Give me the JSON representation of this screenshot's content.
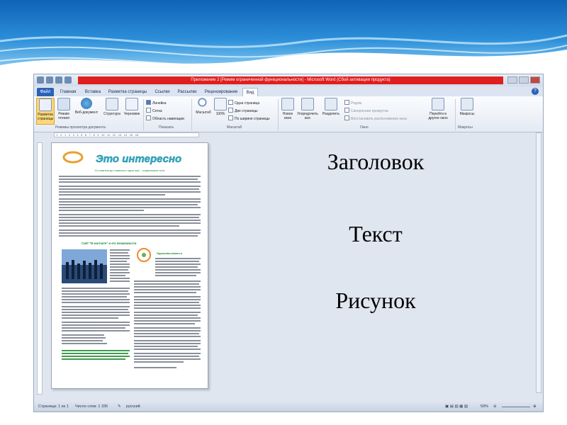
{
  "window": {
    "title": "Приложение 2 [Режим ограниченной функциональности] - Microsoft Word (Сбой активации продукта)"
  },
  "ribbon": {
    "tabs": [
      "Файл",
      "Главная",
      "Вставка",
      "Разметка страницы",
      "Ссылки",
      "Рассылки",
      "Рецензирование",
      "Вид"
    ],
    "active_tab": "Вид",
    "groups": {
      "views": {
        "label": "Режимы просмотра документа",
        "buttons": [
          "Разметка страницы",
          "Режим чтения",
          "Веб-документ",
          "Структура",
          "Черновик"
        ]
      },
      "show": {
        "label": "Показать",
        "options": [
          "Линейка",
          "Сетка",
          "Область навигации"
        ]
      },
      "zoom": {
        "label": "Масштаб",
        "buttons": [
          "Масштаб",
          "100%"
        ],
        "options": [
          "Одна страница",
          "Две страницы",
          "По ширине страницы"
        ]
      },
      "window": {
        "label": "Окно",
        "buttons": [
          "Новое окно",
          "Упорядочить все",
          "Разделить"
        ],
        "options": [
          "Рядом",
          "Синхронная прокрутка",
          "Восстановить расположение окна"
        ],
        "switch": "Перейти в другое окно"
      },
      "macros": {
        "label": "Макросы",
        "button": "Макросы"
      }
    }
  },
  "document": {
    "banner_title": "Это интересно",
    "subtitle": "10 советов до новичкого один шаг - социальные сети",
    "section_title": "Сайт \"В контакте\" и его возможности",
    "side_title": "Одноклассники.ru"
  },
  "status": {
    "page": "Страница: 1 из 1",
    "words": "Число слов: 1 336",
    "lang": "русский",
    "zoom": "59%"
  },
  "labels": {
    "heading": "Заголовок",
    "text": "Текст",
    "picture": "Рисунок"
  }
}
